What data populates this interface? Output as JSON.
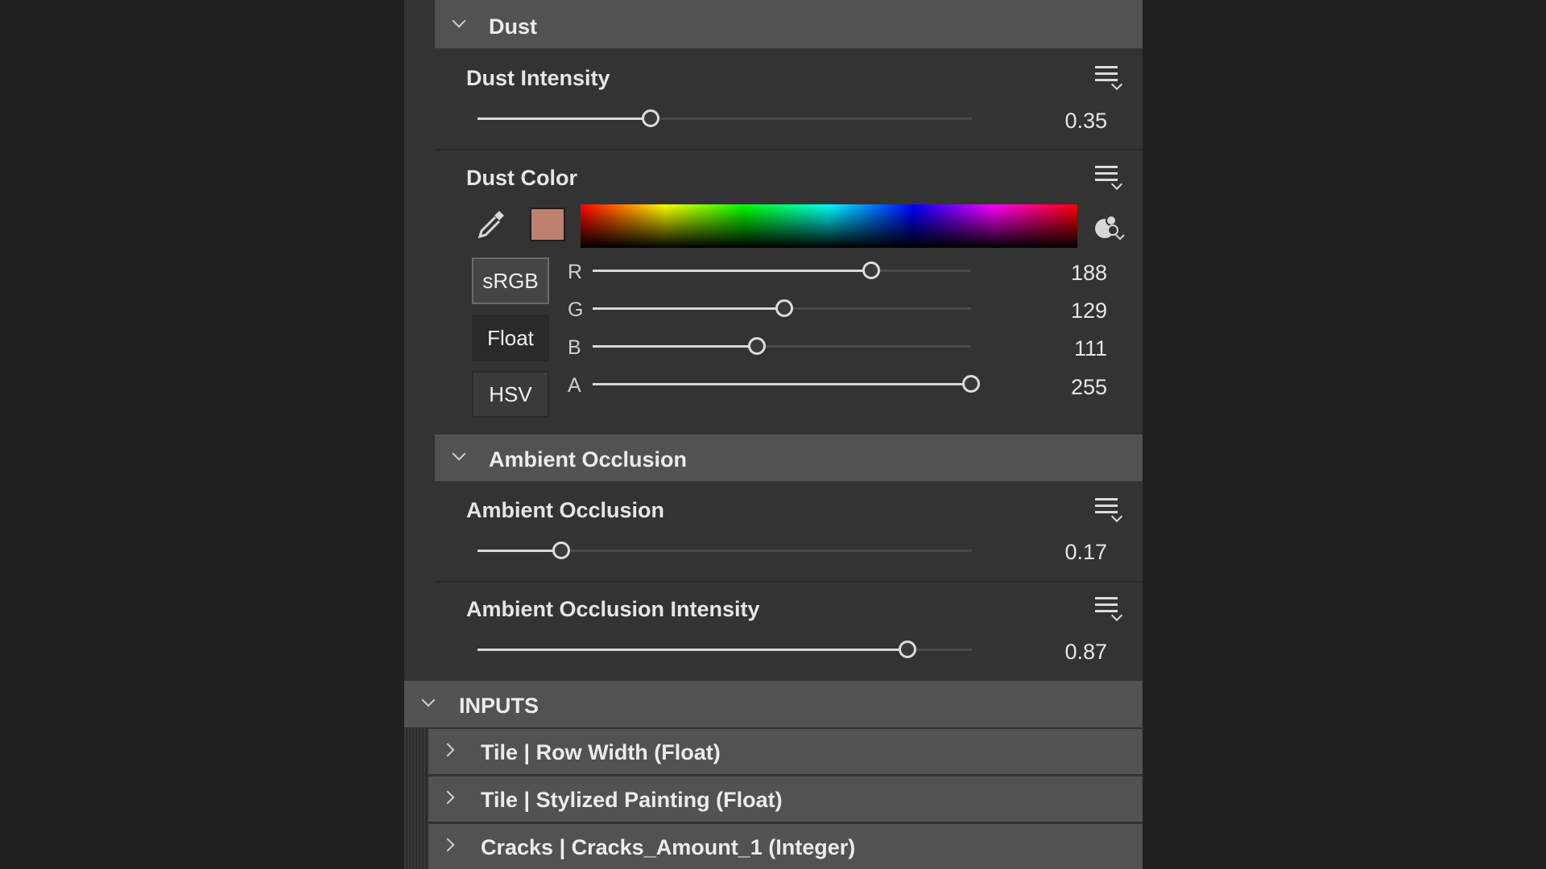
{
  "dust_group": {
    "title": "Dust",
    "dust_intensity": {
      "label": "Dust Intensity",
      "value": "0.35",
      "fraction": 0.35
    },
    "dust_color": {
      "label": "Dust Color",
      "swatch_color": "#bc816f",
      "modes": [
        "sRGB",
        "Float",
        "HSV"
      ],
      "channels": [
        {
          "name": "R",
          "value": "188",
          "fraction": 0.737
        },
        {
          "name": "G",
          "value": "129",
          "fraction": 0.506
        },
        {
          "name": "B",
          "value": "111",
          "fraction": 0.435
        },
        {
          "name": "A",
          "value": "255",
          "fraction": 1.0
        }
      ]
    }
  },
  "ao_group": {
    "title": "Ambient Occlusion",
    "ambient_occlusion": {
      "label": "Ambient Occlusion",
      "value": "0.17",
      "fraction": 0.17
    },
    "ao_intensity": {
      "label": "Ambient Occlusion Intensity",
      "value": "0.87",
      "fraction": 0.87
    }
  },
  "inputs": {
    "title": "INPUTS",
    "items": [
      "Tile | Row Width (Float)",
      "Tile | Stylized Painting (Float)",
      "Cracks | Cracks_Amount_1 (Integer)"
    ]
  }
}
